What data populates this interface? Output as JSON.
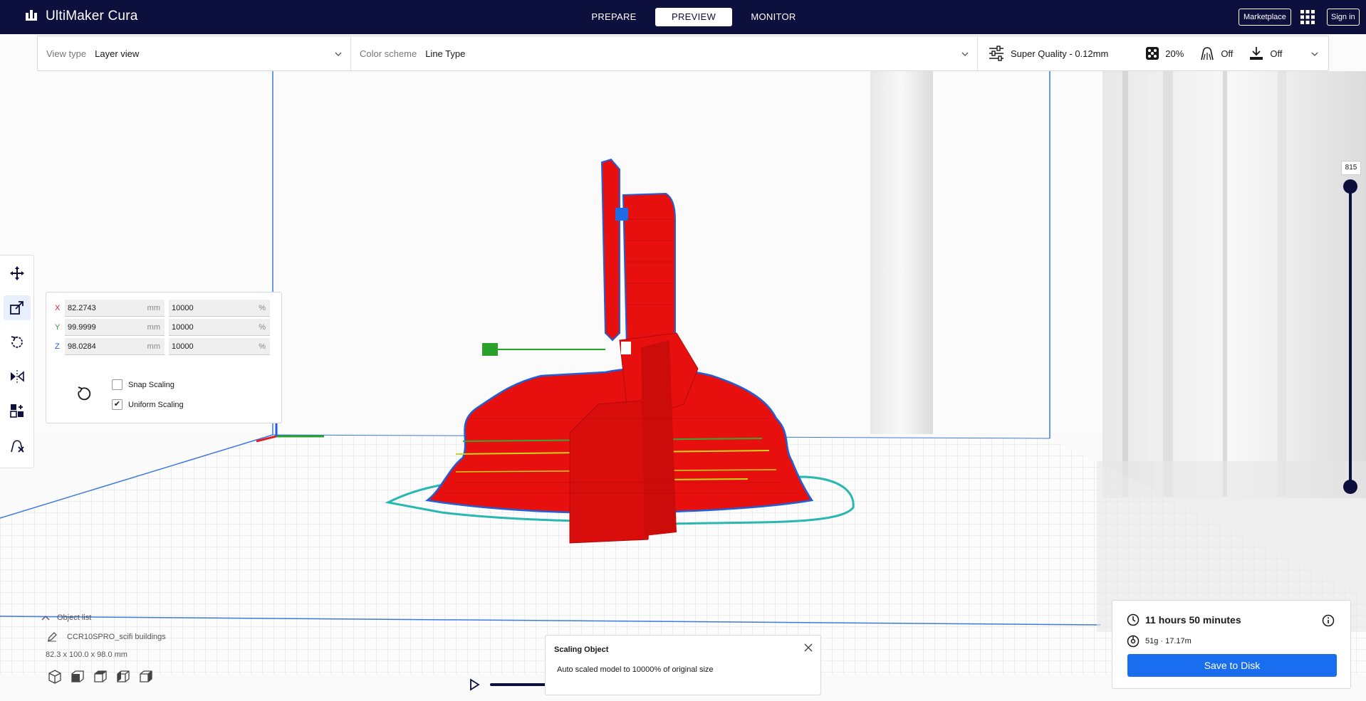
{
  "app": {
    "title": "UltiMaker Cura"
  },
  "topbar": {
    "stages": [
      {
        "label": "PREPARE",
        "active": false
      },
      {
        "label": "PREVIEW",
        "active": true
      },
      {
        "label": "MONITOR",
        "active": false
      }
    ],
    "marketplace_label": "Marketplace",
    "signin_label": "Sign in",
    "apps_icon": "grid-icon"
  },
  "header": {
    "view_type_label": "View type",
    "view_type_value": "Layer view",
    "color_scheme_label": "Color scheme",
    "color_scheme_value": "Line Type",
    "profile": "Super Quality - 0.12mm",
    "infill": "20%",
    "support": "Off",
    "adhesion": "Off"
  },
  "scale_tool": {
    "x": {
      "axis": "X",
      "mm": "82.2743",
      "mm_unit": "mm",
      "pct": "10000",
      "pct_unit": "%"
    },
    "y": {
      "axis": "Y",
      "mm": "99.9999",
      "mm_unit": "mm",
      "pct": "10000",
      "pct_unit": "%"
    },
    "z": {
      "axis": "Z",
      "mm": "98.0284",
      "mm_unit": "mm",
      "pct": "10000",
      "pct_unit": "%"
    },
    "snap_label": "Snap Scaling",
    "snap_checked": false,
    "uniform_label": "Uniform Scaling",
    "uniform_checked": true,
    "uniform_checkmark": "✔"
  },
  "layer_slider": {
    "value": "815"
  },
  "object_list": {
    "toggle_label": "Object list",
    "item_name": "CCR10SPRO_scifi buildings",
    "dimensions": "82.3 x 100.0 x 98.0 mm"
  },
  "toast": {
    "title": "Scaling Object",
    "body": "Auto scaled model to 10000% of original size"
  },
  "print_info": {
    "time": "11 hours 50 minutes",
    "material": "51g · 17.17m",
    "save_label": "Save to Disk"
  },
  "colors": {
    "topbar": "#0d0f3c",
    "accent": "#196ef0",
    "model": "#e8100f",
    "outline": "#1f5fd8"
  }
}
